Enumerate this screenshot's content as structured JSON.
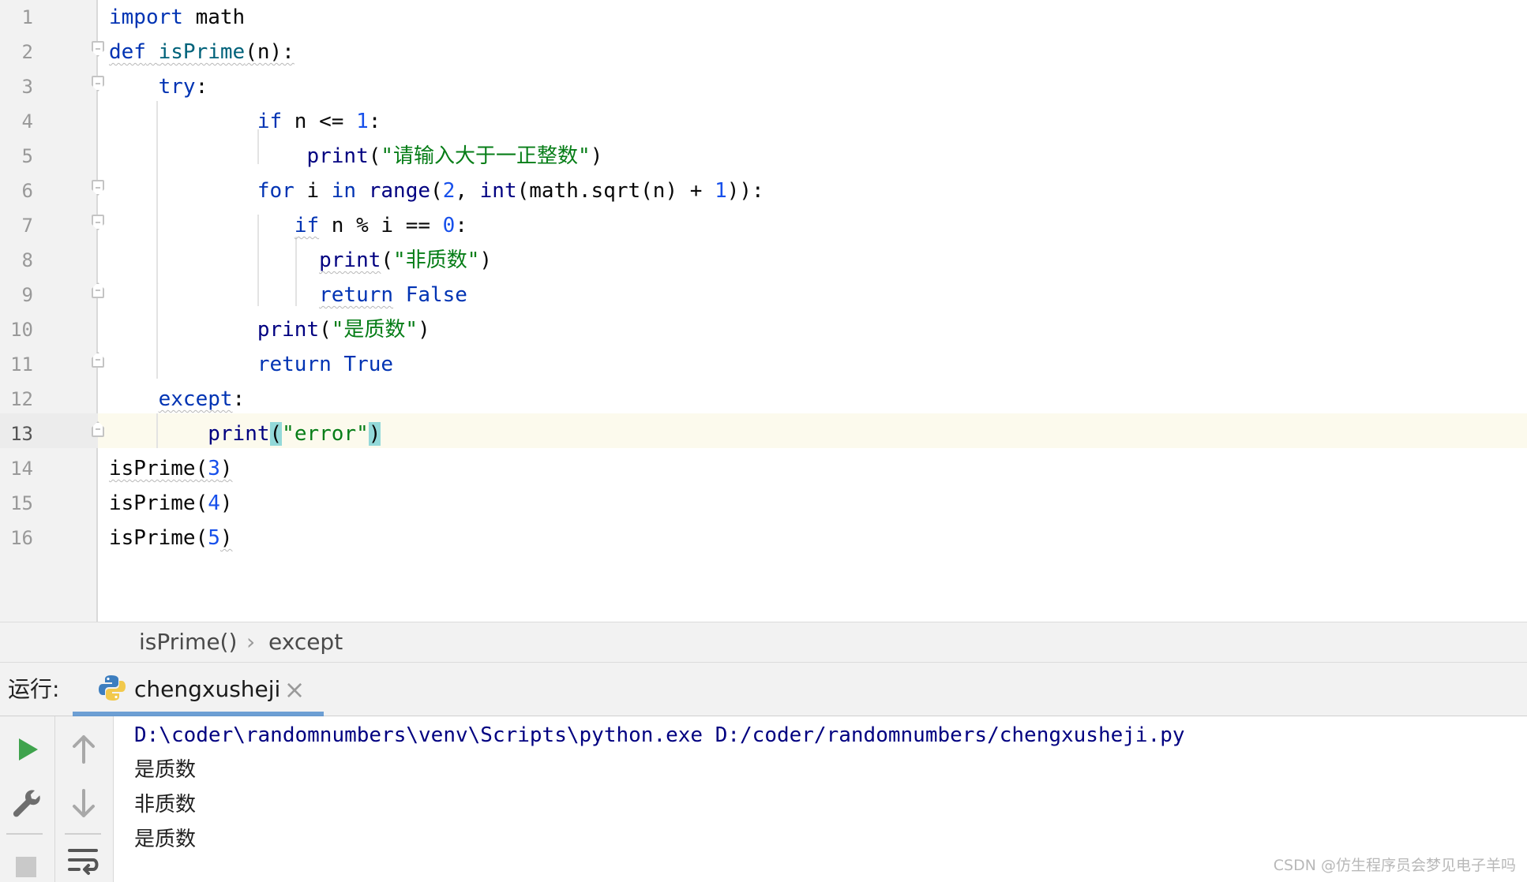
{
  "editor": {
    "line_numbers": [
      "1",
      "2",
      "3",
      "4",
      "5",
      "6",
      "7",
      "8",
      "9",
      "10",
      "11",
      "12",
      "13",
      "14",
      "15",
      "16"
    ],
    "current_line": "13",
    "lines": [
      [
        {
          "t": "import",
          "c": "kw"
        },
        {
          "t": " math",
          "c": "plain"
        }
      ],
      [
        {
          "t": "def",
          "c": "kw squig"
        },
        {
          "t": " ",
          "c": "plain squig"
        },
        {
          "t": "isPrime",
          "c": "fn-name squig"
        },
        {
          "t": "(n):",
          "c": "plain squig"
        }
      ],
      [
        {
          "t": "    ",
          "c": "plain"
        },
        {
          "t": "try",
          "c": "kw"
        },
        {
          "t": ":",
          "c": "plain"
        }
      ],
      [
        {
          "t": "            ",
          "c": "plain"
        },
        {
          "t": "if",
          "c": "kw"
        },
        {
          "t": " n <= ",
          "c": "plain"
        },
        {
          "t": "1",
          "c": "num"
        },
        {
          "t": ":",
          "c": "plain"
        }
      ],
      [
        {
          "t": "                ",
          "c": "plain"
        },
        {
          "t": "print",
          "c": "builtin"
        },
        {
          "t": "(",
          "c": "plain"
        },
        {
          "t": "\"请输入大于一正整数\"",
          "c": "str"
        },
        {
          "t": ")",
          "c": "plain"
        }
      ],
      [
        {
          "t": "            ",
          "c": "plain"
        },
        {
          "t": "for",
          "c": "kw"
        },
        {
          "t": " i ",
          "c": "plain"
        },
        {
          "t": "in",
          "c": "kw"
        },
        {
          "t": " ",
          "c": "plain"
        },
        {
          "t": "range",
          "c": "builtin"
        },
        {
          "t": "(",
          "c": "plain"
        },
        {
          "t": "2",
          "c": "num"
        },
        {
          "t": ", ",
          "c": "plain"
        },
        {
          "t": "int",
          "c": "builtin"
        },
        {
          "t": "(math.sqrt(n) + ",
          "c": "plain"
        },
        {
          "t": "1",
          "c": "num"
        },
        {
          "t": ")):",
          "c": "plain"
        }
      ],
      [
        {
          "t": "               ",
          "c": "plain"
        },
        {
          "t": "if",
          "c": "kw squig"
        },
        {
          "t": " n % i == ",
          "c": "plain"
        },
        {
          "t": "0",
          "c": "num"
        },
        {
          "t": ":",
          "c": "plain"
        }
      ],
      [
        {
          "t": "                 ",
          "c": "plain"
        },
        {
          "t": "print",
          "c": "builtin squig"
        },
        {
          "t": "(",
          "c": "plain"
        },
        {
          "t": "\"非质数\"",
          "c": "str"
        },
        {
          "t": ")",
          "c": "plain"
        }
      ],
      [
        {
          "t": "                 ",
          "c": "plain"
        },
        {
          "t": "return",
          "c": "kw squig"
        },
        {
          "t": " ",
          "c": "plain"
        },
        {
          "t": "False",
          "c": "kw"
        }
      ],
      [
        {
          "t": "            ",
          "c": "plain"
        },
        {
          "t": "print",
          "c": "builtin"
        },
        {
          "t": "(",
          "c": "plain"
        },
        {
          "t": "\"是质数\"",
          "c": "str"
        },
        {
          "t": ")",
          "c": "plain"
        }
      ],
      [
        {
          "t": "            ",
          "c": "plain"
        },
        {
          "t": "return",
          "c": "kw"
        },
        {
          "t": " ",
          "c": "plain"
        },
        {
          "t": "True",
          "c": "kw"
        }
      ],
      [
        {
          "t": "    ",
          "c": "plain"
        },
        {
          "t": "except",
          "c": "kw squig"
        },
        {
          "t": ":",
          "c": "plain"
        }
      ],
      [
        {
          "t": "        ",
          "c": "plain"
        },
        {
          "t": "print",
          "c": "builtin"
        },
        {
          "t": "(",
          "c": "plain brace-match"
        },
        {
          "t": "\"error\"",
          "c": "str"
        },
        {
          "t": ")",
          "c": "plain brace-match"
        }
      ],
      [
        {
          "t": "isPrime(",
          "c": "plain squig"
        },
        {
          "t": "3",
          "c": "num squig"
        },
        {
          "t": ")",
          "c": "plain squig"
        }
      ],
      [
        {
          "t": "isPrime(",
          "c": "plain"
        },
        {
          "t": "4",
          "c": "num"
        },
        {
          "t": ")",
          "c": "plain"
        }
      ],
      [
        {
          "t": "isPrime(",
          "c": "plain"
        },
        {
          "t": "5",
          "c": "num"
        },
        {
          "t": ")",
          "c": "plain squig"
        }
      ]
    ]
  },
  "breadcrumb": {
    "items": [
      "isPrime()",
      "except"
    ],
    "separator": "›"
  },
  "run_panel": {
    "label": "运行:",
    "tab_title": "chengxusheji",
    "tab_close": "×",
    "tool_icons": [
      "play-icon",
      "wrench-icon",
      "stop-icon",
      "arrow-up-icon",
      "arrow-down-icon",
      "soft-wrap-icon"
    ],
    "console": {
      "command": "D:\\coder\\randomnumbers\\venv\\Scripts\\python.exe D:/coder/randomnumbers/chengxusheji.py",
      "output": [
        "是质数",
        "非质数",
        "是质数"
      ]
    }
  },
  "watermark": "CSDN @仿生程序员会梦见电子羊吗",
  "colors": {
    "keyword": "#0033b3",
    "string": "#067d17",
    "number": "#1750eb",
    "function": "#00627a",
    "current_line": "#fcfaed",
    "brace_match": "#93d9d9",
    "tab_underline": "#4083c9"
  }
}
